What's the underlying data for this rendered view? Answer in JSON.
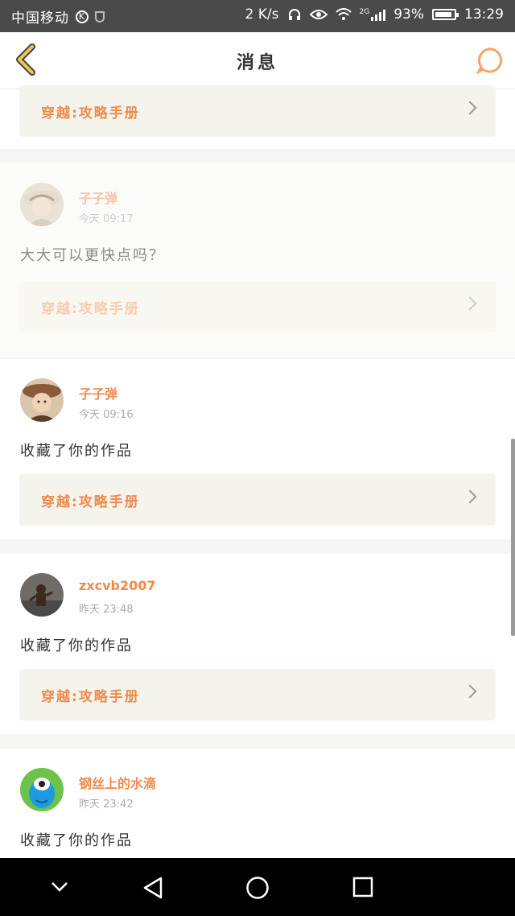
{
  "status": {
    "carrier": "中国移动",
    "k_badge": "K",
    "speed": "2 K/s",
    "net": "2G",
    "battery": "93%",
    "battery_level": 0.93,
    "time": "13:29"
  },
  "header": {
    "title": "消息"
  },
  "messages": [
    {
      "link": "穿越:攻略手册"
    },
    {
      "username": "子子弹",
      "time": "今天 09:17",
      "content": "大大可以更快点吗？",
      "link": "穿越:攻略手册"
    },
    {
      "username": "子子弹",
      "time": "今天 09:16",
      "content": "收藏了你的作品",
      "link": "穿越:攻略手册"
    },
    {
      "username": "zxcvb2007",
      "time": "昨天 23:48",
      "content": "收藏了你的作品",
      "link": "穿越:攻略手册"
    },
    {
      "username": "钢丝上的水滴",
      "time": "昨天 23:42",
      "content": "收藏了你的作品"
    }
  ],
  "colors": {
    "accent": "#f08a4b",
    "back_icon": "#f2c94c",
    "link_bg": "#f5f4ec"
  }
}
